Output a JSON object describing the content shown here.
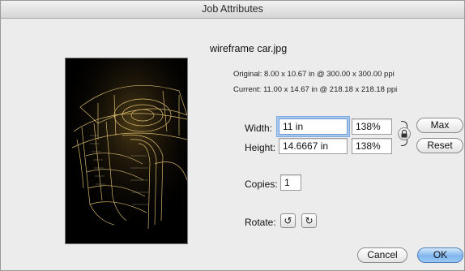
{
  "window": {
    "title": "Job Attributes"
  },
  "file": {
    "name": "wireframe car.jpg"
  },
  "info": {
    "original_label": "Original:",
    "original_value": "8.00 x 10.67 in @ 300.00 x 300.00 ppi",
    "current_label": "Current:",
    "current_value": "11.00 x 14.67 in @ 218.18 x 218.18 ppi"
  },
  "size": {
    "width_label": "Width:",
    "width_value": "11 in",
    "width_percent": "138%",
    "height_label": "Height:",
    "height_value": "14.6667 in",
    "height_percent": "138%"
  },
  "buttons": {
    "max": "Max",
    "reset": "Reset",
    "cancel": "Cancel",
    "ok": "OK"
  },
  "copies": {
    "label": "Copies:",
    "value": "1"
  },
  "rotate": {
    "label": "Rotate:",
    "ccw_icon": "rotate-ccw-icon",
    "cw_icon": "rotate-cw-icon",
    "ccw_glyph": "↺",
    "cw_glyph": "↻"
  },
  "icons": {
    "lock": "lock-icon"
  },
  "colors": {
    "default_button": "#7fb6ee",
    "focus_ring": "#a9c8ee"
  }
}
